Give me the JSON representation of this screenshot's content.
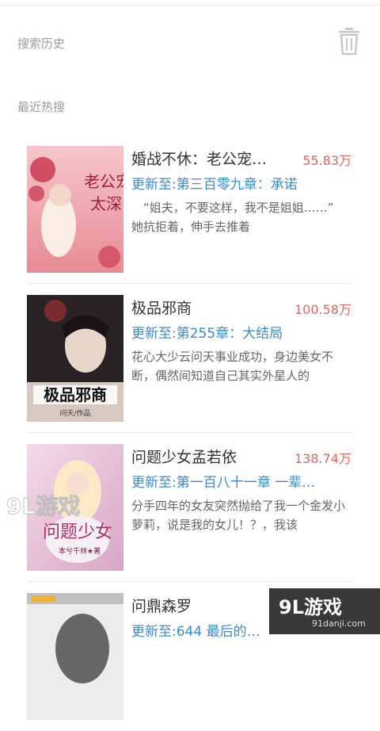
{
  "search_history": {
    "title": "搜索历史",
    "clear_icon": "trash-icon"
  },
  "hot_searches": {
    "title": "最近热搜",
    "items": [
      {
        "title": "婚战不休：老公宠…",
        "count": "55.83万",
        "update": "更新至:第三百零九章：承诺",
        "desc": "　“姐夫，不要这样，我不是姐姐……”　　她抗拒着，伸手去推着",
        "cover_colors": [
          "#f6c7cc",
          "#e88a95",
          "#c8324a"
        ],
        "cover_text": [
          "老公宠",
          "太深"
        ]
      },
      {
        "title": "极品邪商",
        "count": "100.58万",
        "update": "更新至:第255章：大结局",
        "desc": "花心大少云问天事业成功，身边美女不断，偶然间知道自己其实外星人的",
        "cover_colors": [
          "#2a2326",
          "#7b2a2f",
          "#d7c9c1"
        ],
        "cover_text": [
          "极品邪商",
          "问天/作品"
        ]
      },
      {
        "title": "问题少女孟若依",
        "count": "138.74万",
        "update": "更新至:第一百八十一章 一辈…",
        "desc": "分手四年的女友突然抛给了我一个金发小萝莉，说是我的女儿！？，我该",
        "cover_colors": [
          "#f3dbe8",
          "#d8a6c6",
          "#b52c6a"
        ],
        "cover_text": [
          "问题少女",
          "本兮千林★著"
        ]
      },
      {
        "title": "问鼎森罗",
        "count": "",
        "update": "更新至:644 最后的…",
        "desc": "",
        "cover_colors": [
          "#ececec",
          "#c0c0c0",
          "#3a3a3a"
        ],
        "cover_text": [
          "",
          ""
        ]
      }
    ]
  },
  "watermarks": {
    "left_logo": "9L游戏",
    "right_logo": "9L游戏",
    "right_url": "91danji.com"
  }
}
